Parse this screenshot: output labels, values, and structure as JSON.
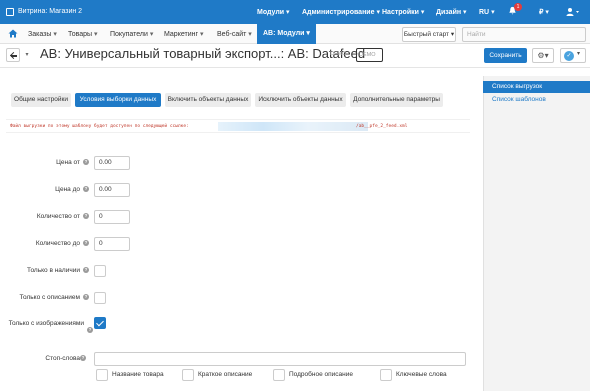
{
  "topbar": {
    "store": "Витрина: Магазин 2",
    "menus": [
      {
        "label": "Модули"
      },
      {
        "label": "Администрирование"
      },
      {
        "label": "Настройки"
      },
      {
        "label": "Дизайн"
      },
      {
        "label": "RU"
      },
      {
        "label": "₽"
      }
    ],
    "notifications": "1",
    "color": "#1f7ac7"
  },
  "subnav": {
    "items": [
      {
        "label": "Заказы"
      },
      {
        "label": "Товары"
      },
      {
        "label": "Покупатели"
      },
      {
        "label": "Маркетинг"
      },
      {
        "label": "Веб-сайт"
      },
      {
        "label": "AB: Модули"
      }
    ],
    "quick_start": "Быстрый старт",
    "search_placeholder": "Найти"
  },
  "titlebar": {
    "title": "AB: Универсальный товарный экспорт...: AB: Datafeed",
    "demo1": "DEMO",
    "demo2": "DEMO",
    "save": "Сохранить"
  },
  "sidebar": {
    "items": [
      {
        "label": "Список выгрузок",
        "active": true
      },
      {
        "label": "Список шаблонов",
        "active": false
      }
    ]
  },
  "tabs": [
    {
      "label": "Общие настройки",
      "active": false
    },
    {
      "label": "Условия выборки данных",
      "active": true
    },
    {
      "label": "Включить объекты данных",
      "active": false
    },
    {
      "label": "Исключить объекты данных",
      "active": false
    },
    {
      "label": "Дополнительные параметры",
      "active": false
    }
  ],
  "link": {
    "text": "Файл выгрузки по этому шаблону будет доступен по следующей ссылке:",
    "url_suffix": "/ab__pfe_2_feed.xml"
  },
  "form": {
    "price_from": {
      "label": "Цена от",
      "value": "0.00"
    },
    "price_to": {
      "label": "Цена до",
      "value": "0.00"
    },
    "qty_from": {
      "label": "Количество от",
      "value": "0"
    },
    "qty_to": {
      "label": "Количество до",
      "value": "0"
    },
    "in_stock": {
      "label": "Только в наличии",
      "checked": false
    },
    "with_desc": {
      "label": "Только с описанием",
      "checked": false
    },
    "with_images": {
      "label": "Только с изображениями",
      "checked": true
    },
    "stopwords": {
      "label": "Стоп-слова",
      "options": [
        {
          "label": "Название товара"
        },
        {
          "label": "Краткое описание"
        },
        {
          "label": "Подробное описание"
        },
        {
          "label": "Ключевые слова"
        }
      ]
    }
  }
}
